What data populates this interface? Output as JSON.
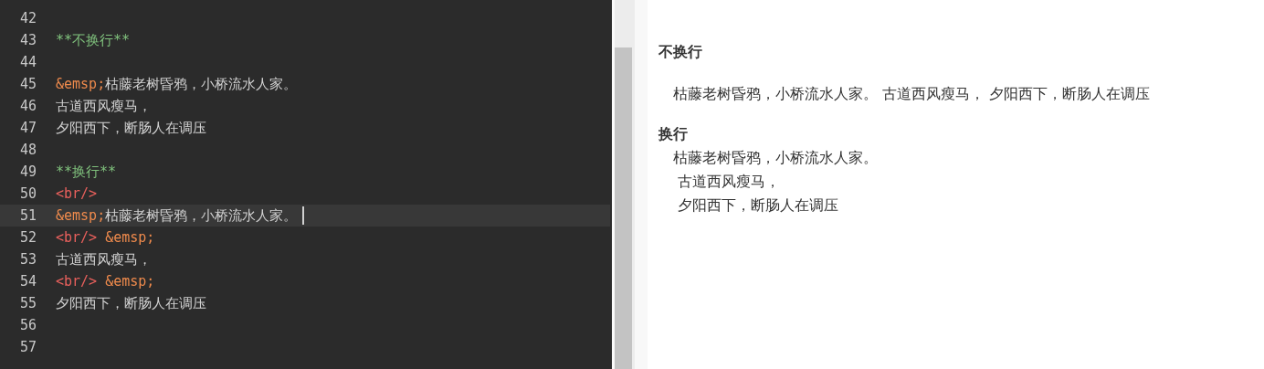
{
  "editor": {
    "lines": [
      {
        "number": "42",
        "current": false
      },
      {
        "number": "43",
        "current": false,
        "tokens": [
          {
            "kind": "heading",
            "text": "**不换行**"
          }
        ]
      },
      {
        "number": "44",
        "current": false
      },
      {
        "number": "45",
        "current": false,
        "tokens": [
          {
            "kind": "entity",
            "text": "&emsp;"
          },
          {
            "kind": "text",
            "text": "枯藤老树昏鸦，小桥流水人家。"
          }
        ]
      },
      {
        "number": "46",
        "current": false,
        "tokens": [
          {
            "kind": "text",
            "text": "古道西风瘦马，"
          }
        ]
      },
      {
        "number": "47",
        "current": false,
        "tokens": [
          {
            "kind": "text",
            "text": "夕阳西下，断肠人在调压"
          }
        ]
      },
      {
        "number": "48",
        "current": false
      },
      {
        "number": "49",
        "current": false,
        "tokens": [
          {
            "kind": "heading",
            "text": "**换行**"
          }
        ]
      },
      {
        "number": "50",
        "current": false,
        "tokens": [
          {
            "kind": "tag",
            "text": "<br/>"
          }
        ]
      },
      {
        "number": "51",
        "current": true,
        "tokens": [
          {
            "kind": "entity",
            "text": "&emsp;"
          },
          {
            "kind": "text",
            "text": "枯藤老树昏鸦，小桥流水人家。"
          }
        ]
      },
      {
        "number": "52",
        "current": false,
        "tokens": [
          {
            "kind": "tag",
            "text": "<br/>"
          },
          {
            "kind": "entity",
            "text": "&emsp;"
          }
        ]
      },
      {
        "number": "53",
        "current": false,
        "tokens": [
          {
            "kind": "text",
            "text": "古道西风瘦马，"
          }
        ]
      },
      {
        "number": "54",
        "current": false,
        "tokens": [
          {
            "kind": "tag",
            "text": "<br/>"
          },
          {
            "kind": "entity",
            "text": "&emsp;"
          }
        ]
      },
      {
        "number": "55",
        "current": false,
        "tokens": [
          {
            "kind": "text",
            "text": "夕阳西下，断肠人在调压"
          }
        ]
      },
      {
        "number": "56",
        "current": false
      },
      {
        "number": "57",
        "current": false
      }
    ]
  },
  "preview": {
    "blocks": [
      {
        "kind": "heading",
        "text": "不换行"
      },
      {
        "kind": "paragraph",
        "lines": [
          " 枯藤老树昏鸦，小桥流水人家。 古道西风瘦马， 夕阳西下，断肠人在调压"
        ]
      },
      {
        "kind": "heading",
        "text": "换行"
      },
      {
        "kind": "paragraph",
        "lines": [
          " 枯藤老树昏鸦，小桥流水人家。",
          "  古道西风瘦马，",
          "  夕阳西下，断肠人在调压"
        ]
      }
    ]
  }
}
